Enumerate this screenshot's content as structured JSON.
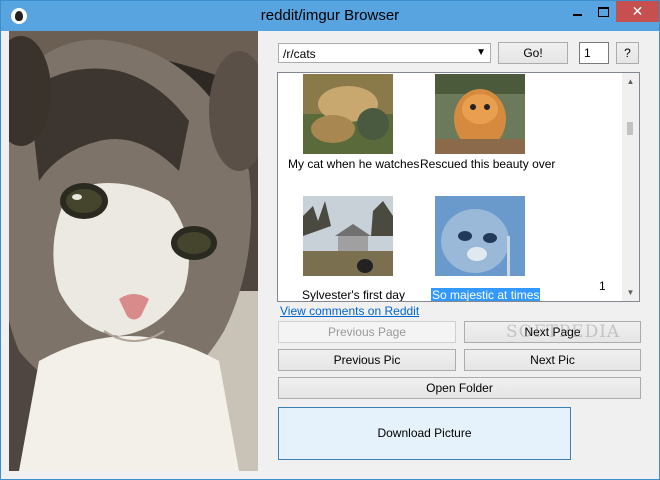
{
  "window": {
    "title": "reddit/imgur Browser",
    "controls": {
      "close": "✕"
    }
  },
  "toolbar": {
    "subreddit_value": "/r/cats",
    "go_label": "Go!",
    "page_number": "1",
    "help_label": "?"
  },
  "gallery": {
    "items": [
      {
        "caption": "My cat when he watches",
        "selected": false
      },
      {
        "caption": "Rescued this beauty over",
        "selected": false
      },
      {
        "caption": "Sylvester's first day",
        "selected": false
      },
      {
        "caption": "So majestic at times",
        "selected": true
      }
    ],
    "page_indicator": "1"
  },
  "actions": {
    "comments_link": "View comments on Reddit",
    "previous_page": "Previous Page",
    "next_page": "Next Page",
    "previous_pic": "Previous Pic",
    "next_pic": "Next Pic",
    "open_folder": "Open Folder",
    "download": "Download Picture"
  },
  "watermark": "SOFTPEDIA",
  "colors": {
    "titlebar": "#57a4e0",
    "close_button": "#c74f4f",
    "selection": "#3399ff",
    "link": "#0066cc"
  }
}
